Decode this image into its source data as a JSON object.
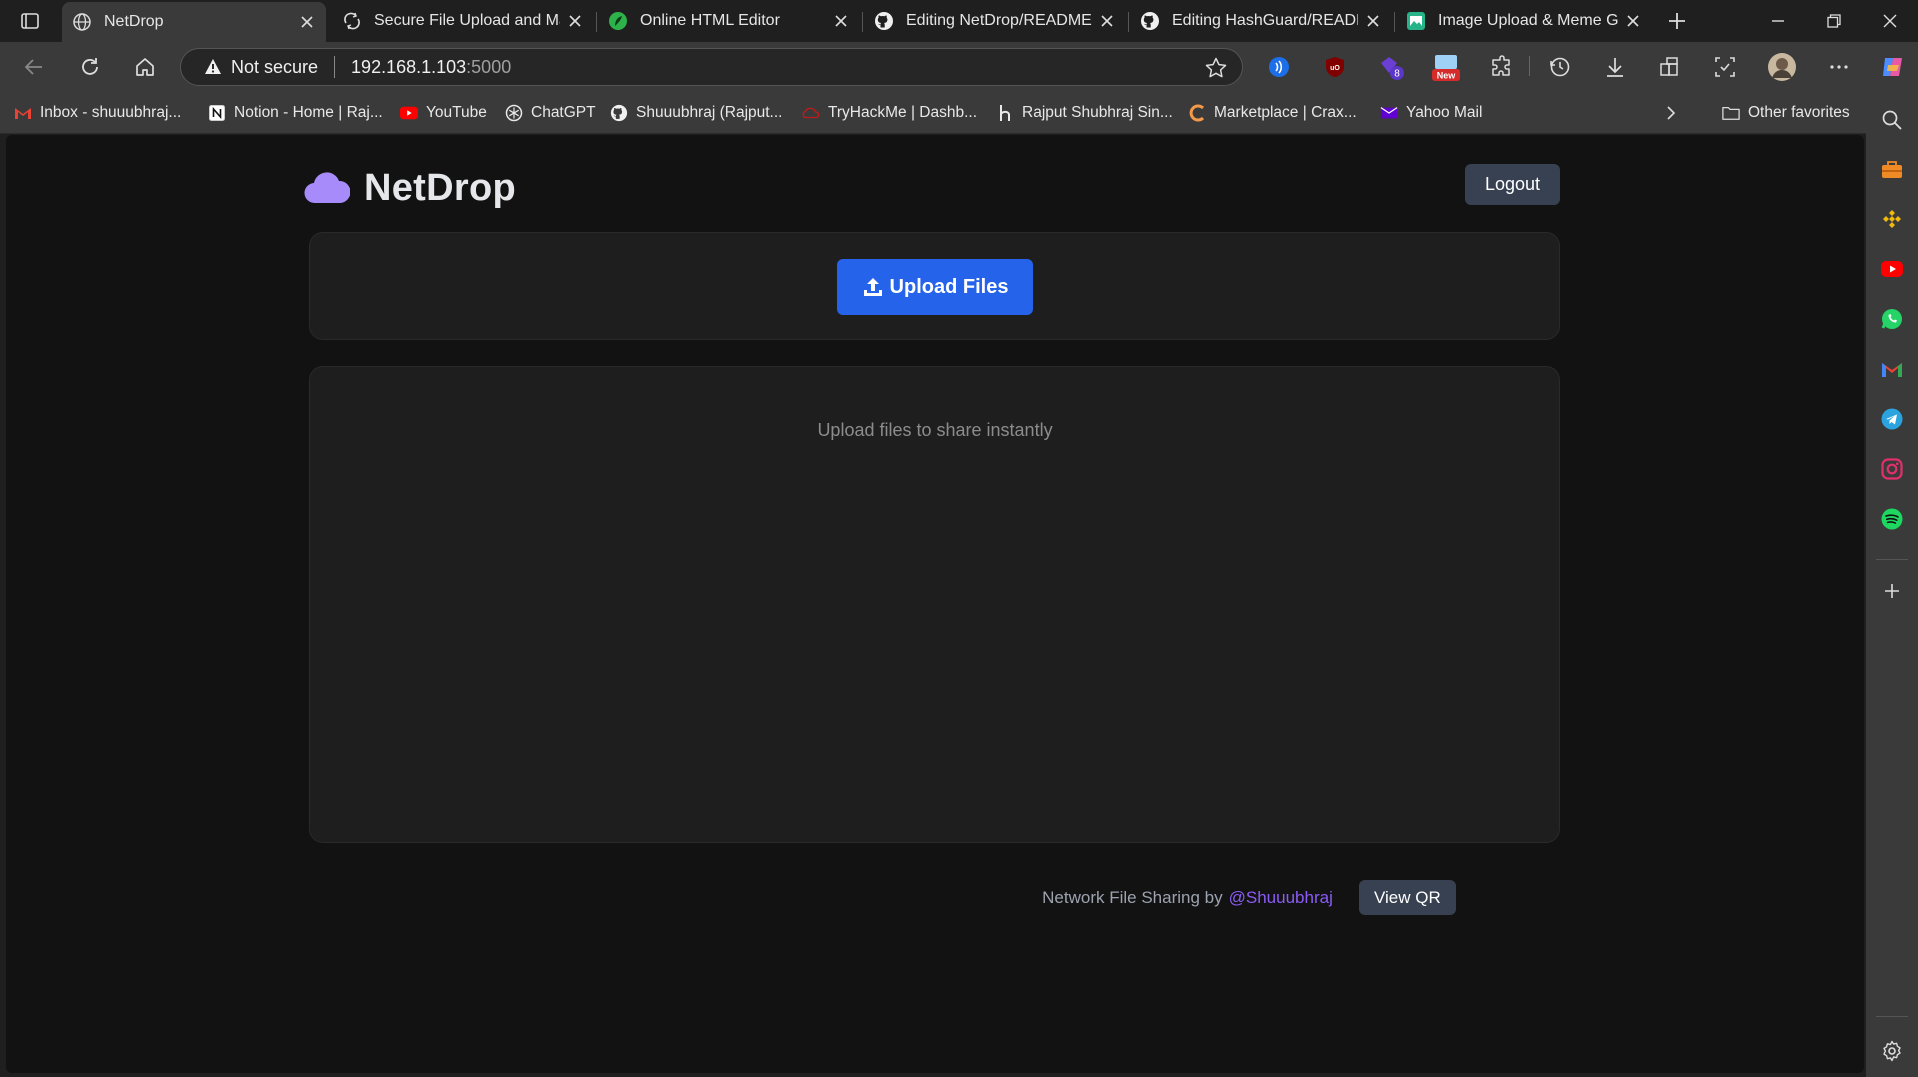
{
  "browser": {
    "tabs": [
      {
        "label": "NetDrop",
        "icon": "globe-icon",
        "active": true
      },
      {
        "label": "Secure File Upload and Management",
        "icon": "sync-icon"
      },
      {
        "label": "Online HTML Editor",
        "icon": "editor-leaf-icon"
      },
      {
        "label": "Editing NetDrop/README.md",
        "icon": "github-icon"
      },
      {
        "label": "Editing HashGuard/README.md",
        "icon": "github-icon"
      },
      {
        "label": "Image Upload & Meme Generator",
        "icon": "image-app-icon"
      }
    ],
    "address": {
      "security_label": "Not secure",
      "host": "192.168.1.103",
      "port": ":5000"
    },
    "bookmarks": [
      {
        "label": "Inbox - shuuubhraj...",
        "icon": "gmail-icon"
      },
      {
        "label": "Notion - Home | Raj...",
        "icon": "notion-icon"
      },
      {
        "label": "YouTube",
        "icon": "youtube-icon"
      },
      {
        "label": "ChatGPT",
        "icon": "chatgpt-icon"
      },
      {
        "label": "Shuuubhraj (Rajput...",
        "icon": "github-icon"
      },
      {
        "label": "TryHackMe | Dashb...",
        "icon": "tryhackme-icon"
      },
      {
        "label": "Rajput Shubhraj Sin...",
        "icon": "hackerrank-icon"
      },
      {
        "label": "Marketplace | Crax...",
        "icon": "crax-icon"
      },
      {
        "label": "Yahoo Mail",
        "icon": "yahoo-mail-icon"
      }
    ],
    "other_favorites": "Other favorites",
    "extension_badges": {
      "count": "8",
      "new": "New"
    }
  },
  "app": {
    "brand": "NetDrop",
    "logout_label": "Logout",
    "upload_label": "Upload Files",
    "empty_message": "Upload files to share instantly",
    "footer_text": "Network File Sharing by",
    "footer_link": "@Shuuubhraj",
    "qr_label": "View QR",
    "colors": {
      "primary": "#2563eb",
      "accent": "#8b5cf6",
      "button_dark": "#374151",
      "background": "#121212",
      "card": "#1e1e1e"
    }
  }
}
